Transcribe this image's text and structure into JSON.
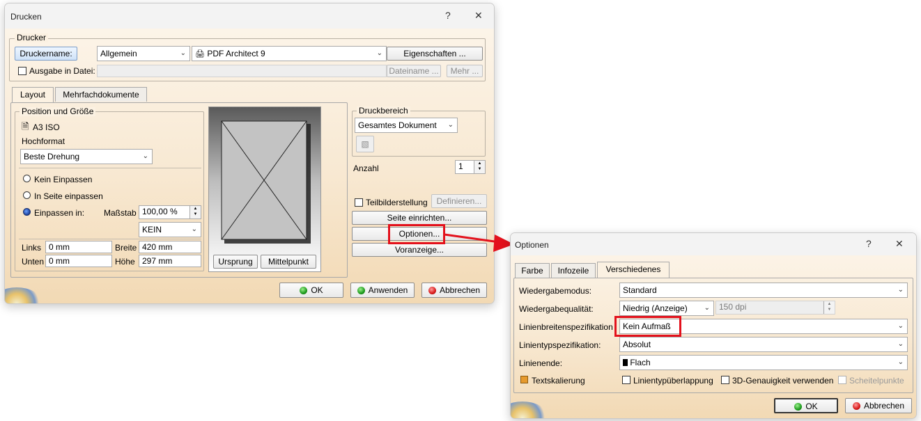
{
  "print": {
    "title": "Drucken",
    "help": "?",
    "close": "✕",
    "printer_group": "Drucker",
    "printer_name_btn": "Druckername:",
    "printer_category": "Allgemein",
    "printer_name": "PDF Architect 9",
    "properties_btn": "Eigenschaften ...",
    "output_to_file": "Ausgabe in Datei:",
    "filename_btn": "Dateiname ...",
    "more_btn": "Mehr ...",
    "tabs": [
      "Layout",
      "Mehrfachdokumente"
    ],
    "position_group": "Position und Größe",
    "paper": "A3 ISO",
    "orientation": "Hochformat",
    "rotation": "Beste Drehung",
    "fit_none": "Kein Einpassen",
    "fit_page": "In Seite einpassen",
    "fit_in": "Einpassen in:",
    "scale_label": "Maßstab",
    "scale_value": "100,00 %",
    "scale_mode": "KEIN",
    "left_label": "Links",
    "left_value": "0 mm",
    "bottom_label": "Unten",
    "bottom_value": "0 mm",
    "width_label": "Breite",
    "width_value": "420 mm",
    "height_label": "Höhe",
    "height_value": "297 mm",
    "origin_btn": "Ursprung",
    "center_btn": "Mittelpunkt",
    "range_group": "Druckbereich",
    "range_value": "Gesamtes Dokument",
    "copies_label": "Anzahl",
    "copies_value": "1",
    "tiling_label": "Teilbilderstellung",
    "define_btn": "Definieren...",
    "page_setup_btn": "Seite einrichten...",
    "options_btn": "Optionen...",
    "preview_btn": "Voranzeige...",
    "ok_btn": "OK",
    "apply_btn": "Anwenden",
    "cancel_btn": "Abbrechen"
  },
  "options": {
    "title": "Optionen",
    "help": "?",
    "close": "✕",
    "tabs": [
      "Farbe",
      "Infozeile",
      "Verschiedenes"
    ],
    "render_mode_label": "Wiedergabemodus:",
    "render_mode_value": "Standard",
    "render_quality_label": "Wiedergabequalität:",
    "render_quality_value": "Niedrig (Anzeige)",
    "dpi_value": "150  dpi",
    "line_width_label": "Linienbreitenspezifikation",
    "line_width_value": "Kein Aufmaß",
    "line_type_label": "Linientypspezifikation:",
    "line_type_value": "Absolut",
    "line_end_label": "Linienende:",
    "line_end_value": "Flach",
    "text_scaling": "Textskalierung",
    "line_type_overlap": "Linientypüberlappung",
    "accuracy_3d": "3D-Genauigkeit verwenden",
    "vertices": "Scheitelpunkte",
    "ok_btn": "OK",
    "cancel_btn": "Abbrechen"
  },
  "colors": {
    "highlight": "#e3111c",
    "dialog_bg": "#f8e9d3"
  }
}
